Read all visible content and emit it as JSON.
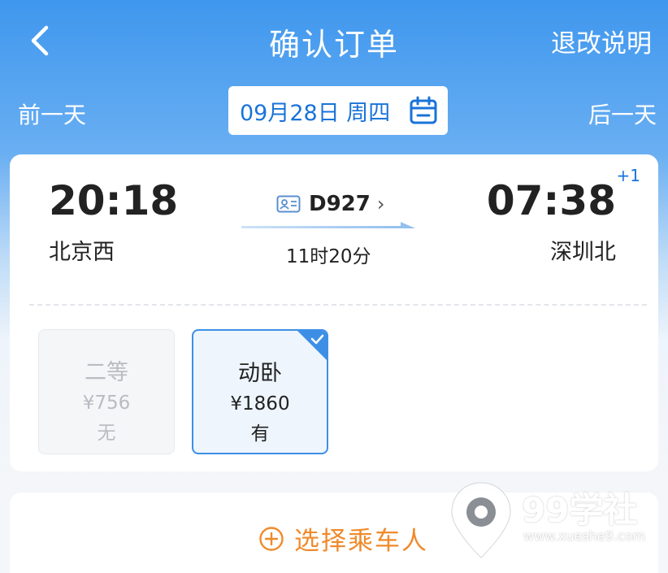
{
  "header": {
    "title": "确认订单",
    "right_link": "退改说明",
    "back_icon": "chevron-left-icon"
  },
  "date_bar": {
    "prev_label": "前一天",
    "next_label": "后一天",
    "date_text": "09月28日 周四",
    "calendar_icon": "calendar-icon"
  },
  "trip": {
    "departure_time": "20:18",
    "departure_station": "北京西",
    "arrival_time": "07:38",
    "arrival_day_offset": "+1",
    "arrival_station": "深圳北",
    "train_number": "D927",
    "train_chevron": "›",
    "duration": "11时20分"
  },
  "seats": [
    {
      "name": "二等",
      "price": "¥756",
      "availability": "无",
      "selected": false
    },
    {
      "name": "动卧",
      "price": "¥1860",
      "availability": "有",
      "selected": true
    }
  ],
  "passenger": {
    "add_label": "选择乘车人"
  },
  "watermark": {
    "brand": "99学社",
    "url": "www.xueshe9.com"
  },
  "colors": {
    "primary_blue": "#3f97ee",
    "accent_orange": "#f08a2a",
    "link_blue": "#1a73d9"
  }
}
